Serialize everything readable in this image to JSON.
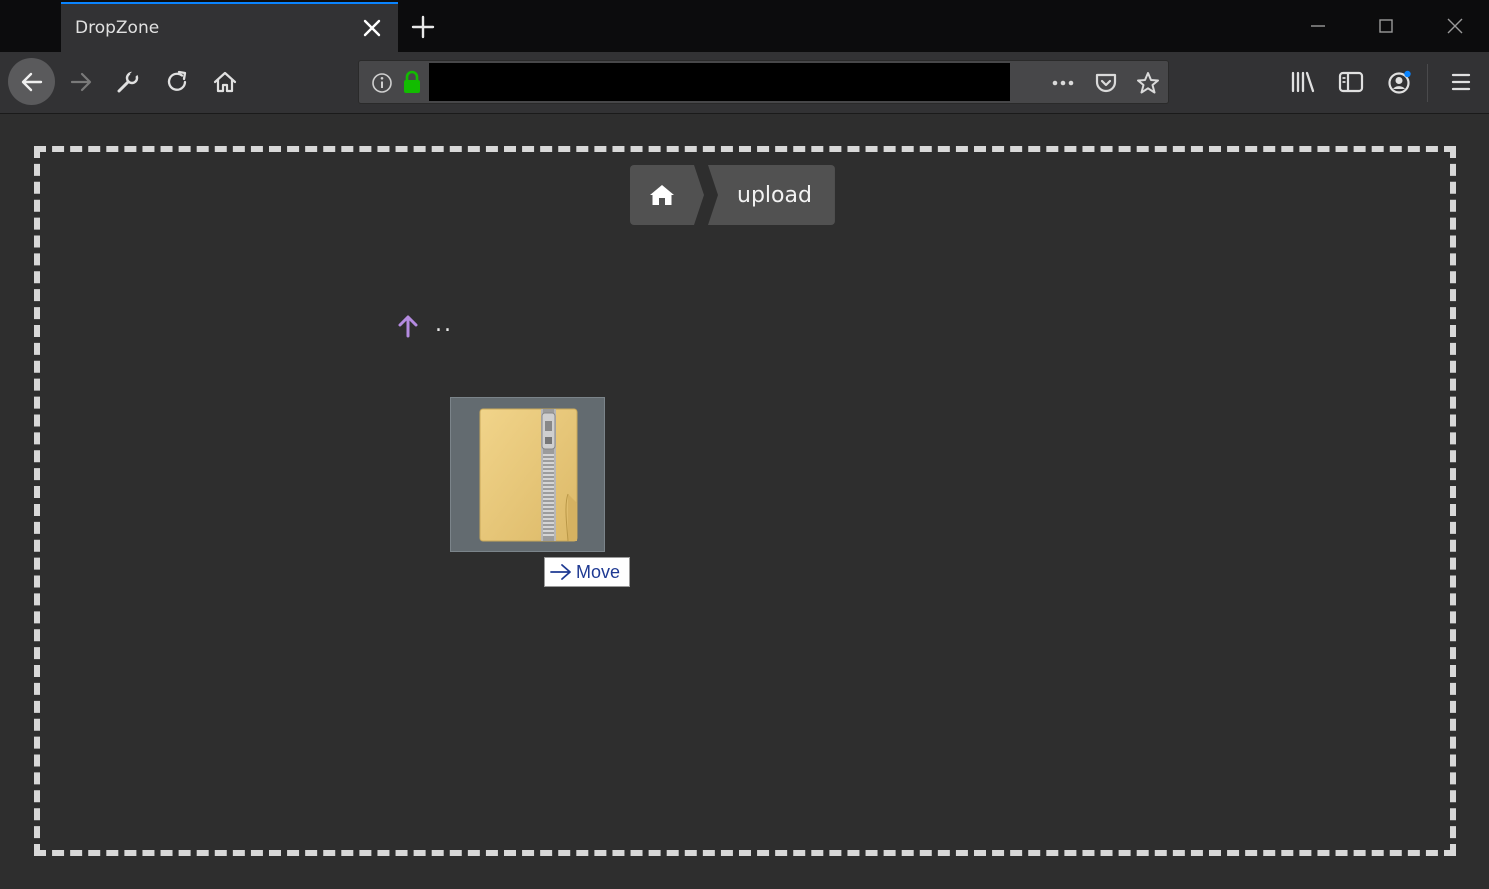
{
  "browser": {
    "tab_title": "DropZone",
    "url": ""
  },
  "breadcrumb": {
    "current_folder": "upload"
  },
  "listing": {
    "parent_label": ".."
  },
  "drag_tooltip": {
    "label": "Move"
  },
  "colors": {
    "tab_accent": "#0a84ff",
    "lock_green": "#12bc00",
    "up_arrow": "#b48be0",
    "dashed_border": "#d8d8d8"
  }
}
